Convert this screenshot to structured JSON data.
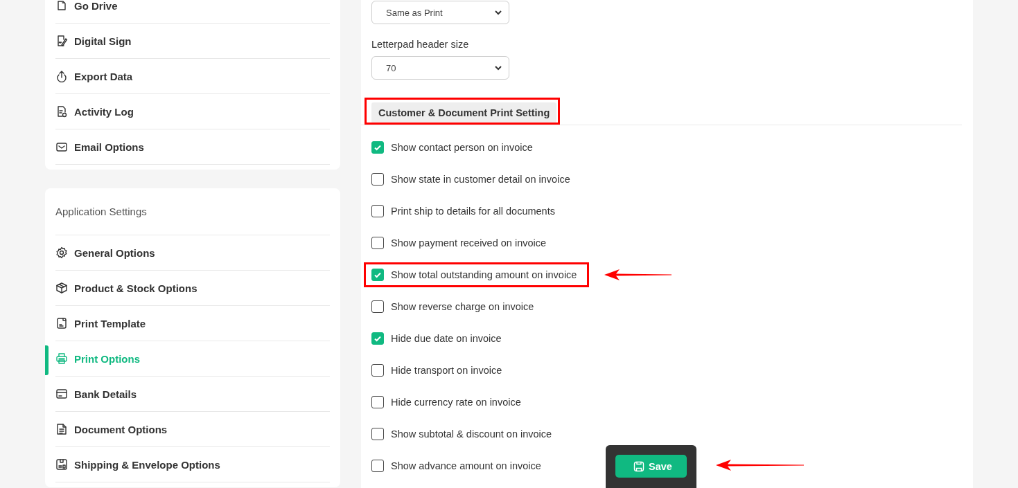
{
  "sidebar": {
    "cards": [
      {
        "items": [
          {
            "label": "Go Drive",
            "selected": false
          },
          {
            "label": "Digital Sign",
            "selected": false
          },
          {
            "label": "Export Data",
            "selected": false
          },
          {
            "label": "Activity Log",
            "selected": false
          },
          {
            "label": "Email Options",
            "selected": false
          }
        ]
      },
      {
        "title": "Application Settings",
        "items": [
          {
            "label": "General Options",
            "selected": false
          },
          {
            "label": "Product & Stock Options",
            "selected": false
          },
          {
            "label": "Print Template",
            "selected": false
          },
          {
            "label": "Print Options",
            "selected": true
          },
          {
            "label": "Bank Details",
            "selected": false
          },
          {
            "label": "Document Options",
            "selected": false
          },
          {
            "label": "Shipping & Envelope Options",
            "selected": false
          }
        ]
      }
    ]
  },
  "main": {
    "fields": [
      {
        "value": "Same as Print"
      },
      {
        "label": "Letterpad header size",
        "value": "70"
      }
    ],
    "section": {
      "title": "Customer & Document Print Setting",
      "framed": true
    },
    "options": [
      {
        "label": "Show contact person on invoice",
        "checked": true,
        "framed": false,
        "arrowed": false
      },
      {
        "label": "Show state in customer detail on invoice",
        "checked": false,
        "framed": false,
        "arrowed": false
      },
      {
        "label": "Print ship to details for all documents",
        "checked": false,
        "framed": false,
        "arrowed": false
      },
      {
        "label": "Show payment received on invoice",
        "checked": false,
        "framed": false,
        "arrowed": false
      },
      {
        "label": "Show total outstanding amount on invoice",
        "checked": true,
        "framed": true,
        "arrowed": true
      },
      {
        "label": "Show reverse charge on invoice",
        "checked": false,
        "framed": false,
        "arrowed": false
      },
      {
        "label": "Hide due date on invoice",
        "checked": true,
        "framed": false,
        "arrowed": false
      },
      {
        "label": "Hide transport on invoice",
        "checked": false,
        "framed": false,
        "arrowed": false
      },
      {
        "label": "Hide currency rate on invoice",
        "checked": false,
        "framed": false,
        "arrowed": false
      },
      {
        "label": "Show subtotal & discount on invoice",
        "checked": false,
        "framed": false,
        "arrowed": false
      },
      {
        "label": "Show advance amount on invoice",
        "checked": false,
        "framed": false,
        "arrowed": false
      }
    ],
    "save": {
      "label": "Save",
      "arrowed": true
    }
  }
}
